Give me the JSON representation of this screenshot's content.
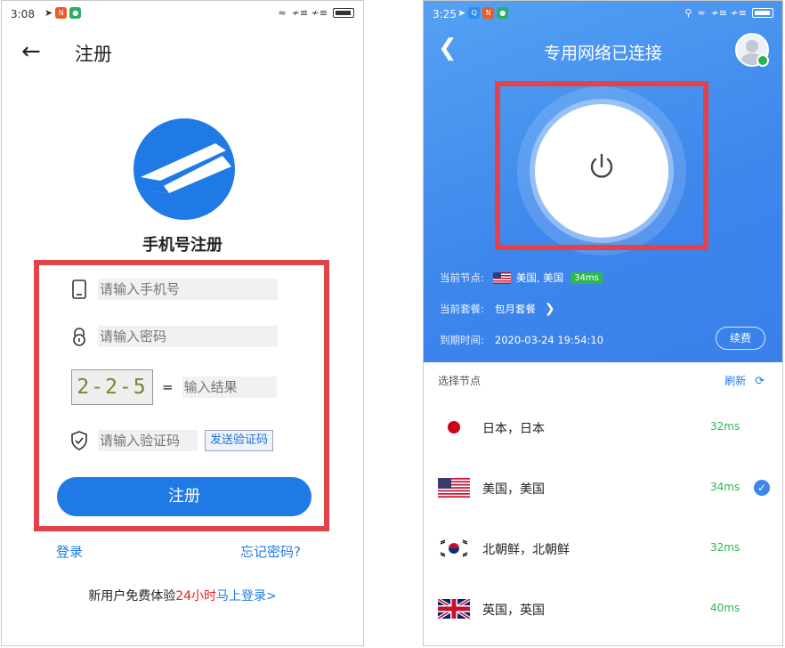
{
  "left": {
    "status": {
      "time": "3:08",
      "signal": "≁≡ ≁≡"
    },
    "title": "注册",
    "subtitle": "手机号注册",
    "form": {
      "phone_placeholder": "请输入手机号",
      "password_placeholder": "请输入密码",
      "captcha_text": "2-2-5",
      "equals": "=",
      "captcha_result_placeholder": "输入结果",
      "code_placeholder": "请输入验证码",
      "send_code_label": "发送验证码"
    },
    "register_label": "注册",
    "login_link": "登录",
    "forgot_link": "忘记密码?",
    "promo": {
      "prefix": "新用户免费体验",
      "highlight": "24小时",
      "link": "马上登录>"
    }
  },
  "right": {
    "status": {
      "time": "3:25",
      "signal": "≁≡ ≁≡"
    },
    "title": "专用网络已连接",
    "current_node_label": "当前节点:",
    "current_node_value": "美国, 美国",
    "current_node_ping": "34ms",
    "current_plan_label": "当前套餐:",
    "current_plan_value": "包月套餐",
    "expire_label": "到期时间:",
    "expire_value": "2020-03-24 19:54:10",
    "renew_label": "续费",
    "select_node_label": "选择节点",
    "refresh_label": "刷新",
    "nodes": [
      {
        "name": "日本，日本",
        "ping": "32ms",
        "flag": "jp-flag-icon"
      },
      {
        "name": "美国，美国",
        "ping": "34ms",
        "flag": "us-flag-icon",
        "selected": true
      },
      {
        "name": "北朝鲜，北朝鲜",
        "ping": "32ms",
        "flag": "kr-flag-icon"
      },
      {
        "name": "英国，英国",
        "ping": "40ms",
        "flag": "uk-flag-icon"
      }
    ]
  },
  "colors": {
    "accent": "#1f7ae6",
    "highlight_box": "#e2434a",
    "ping_green": "#2fb555",
    "header_blue": "#3c86ec"
  }
}
